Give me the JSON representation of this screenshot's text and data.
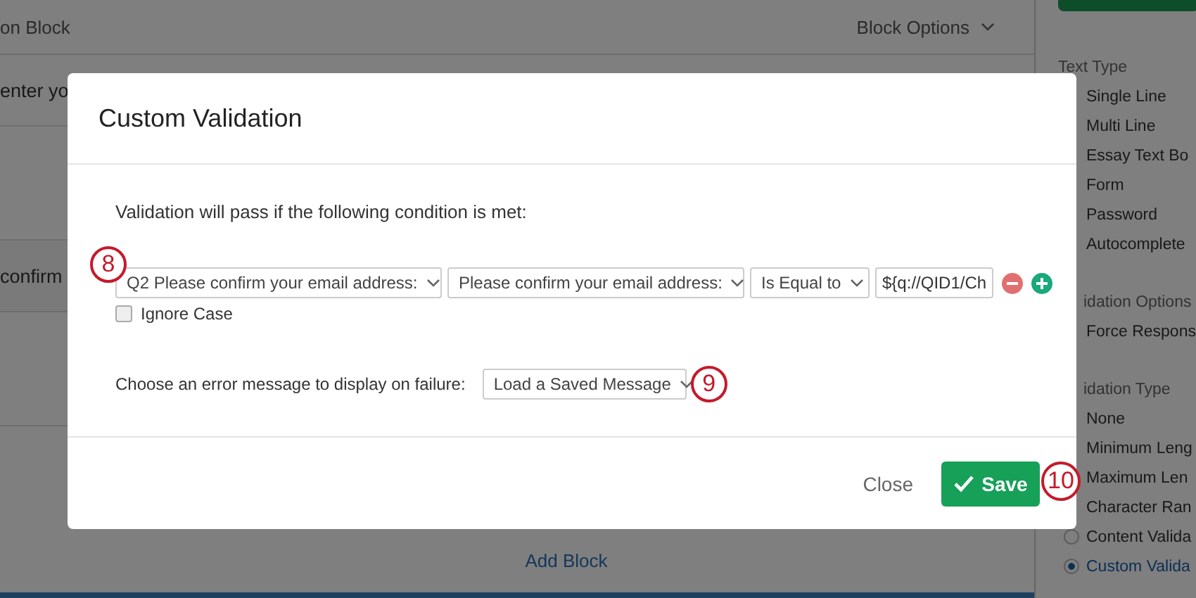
{
  "editor": {
    "block_title": "on Block",
    "block_options": "Block Options",
    "rows": [
      "enter yo",
      "confirm"
    ],
    "add_block": "Add Block"
  },
  "sidebar": {
    "sections": [
      {
        "heading": "Text Type",
        "options": [
          {
            "label": "Single Line",
            "kind": "covered"
          },
          {
            "label": "Multi Line",
            "kind": "covered"
          },
          {
            "label": "Essay Text Bo",
            "kind": "covered"
          },
          {
            "label": "Form",
            "kind": "covered"
          },
          {
            "label": "Password",
            "kind": "covered"
          },
          {
            "label": "Autocomplete",
            "kind": "covered"
          }
        ]
      },
      {
        "heading": "idation Options",
        "options": [
          {
            "label": "Force Respons",
            "kind": "covered"
          }
        ]
      },
      {
        "heading": "idation Type",
        "options": [
          {
            "label": "None",
            "kind": "covered"
          },
          {
            "label": "Minimum Leng",
            "kind": "covered"
          },
          {
            "label": "Maximum Len",
            "kind": "covered"
          },
          {
            "label": "Character Ran",
            "kind": "covered"
          },
          {
            "label": "Content Valida",
            "kind": "radio",
            "selected": false
          },
          {
            "label": "Custom Valida",
            "kind": "radio",
            "selected": true
          }
        ]
      }
    ]
  },
  "dialog": {
    "title": "Custom Validation",
    "intro": "Validation will pass if the following condition is met:",
    "condition": {
      "question": "Q2 Please confirm your email address:",
      "field": "Please confirm your email address:",
      "operator": "Is Equal to",
      "value": "${q://QID1/Ch"
    },
    "ignore_case": {
      "label": "Ignore Case",
      "checked": false
    },
    "error_message": {
      "label": "Choose an error message to display on failure:",
      "value": "Load a Saved Message"
    },
    "buttons": [
      {
        "label": "Close",
        "kind": "link"
      },
      {
        "label": "Save",
        "kind": "primary"
      }
    ]
  },
  "callouts": [
    "8",
    "9",
    "10"
  ]
}
